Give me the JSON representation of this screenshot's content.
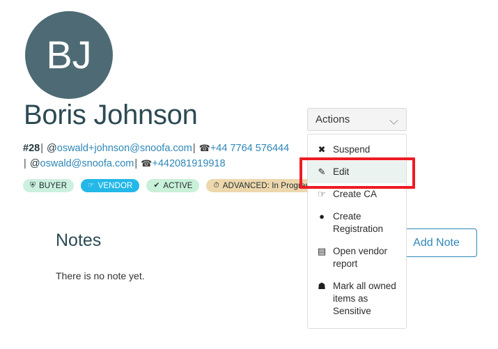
{
  "profile": {
    "avatar_initials": "BJ",
    "avatar_color": "#4e6b75",
    "name": "Boris Johnson",
    "id_label": "#28",
    "email_primary": "oswald+johnson@snoofa.com",
    "phone_primary": "+44 7764 576444",
    "email_secondary": "oswald@snoofa.com",
    "phone_secondary": "+442081919918",
    "separator": "|",
    "at_symbol": "@",
    "phone_icon_glyph": "☎",
    "link_color": "#2d87b8"
  },
  "badges": [
    {
      "label": "BUYER",
      "icon": "⛏",
      "icon_name": "basket-icon",
      "bg": "#ccf0e0",
      "fg": "#1f2b2b"
    },
    {
      "label": "VENDOR",
      "icon": "☞",
      "icon_name": "handshake-icon",
      "bg": "#23b8e8",
      "fg": "#ffffff"
    },
    {
      "label": "ACTIVE",
      "icon": "✔",
      "icon_name": "check-icon",
      "bg": "#c9f0d8",
      "fg": "#1f2b2b"
    },
    {
      "label": "ADVANCED: In Progress",
      "icon": "◴",
      "icon_name": "clock-icon",
      "bg": "#edd7ad",
      "fg": "#1f2b2b"
    }
  ],
  "notes": {
    "title": "Notes",
    "empty_message": "There is no note yet.",
    "add_button_label": "Add Note"
  },
  "actions": {
    "toggle_label": "Actions",
    "chevron_icon": "chevron-down-icon",
    "expanded": true,
    "items": [
      {
        "label": "Suspend",
        "icon": "✖",
        "icon_name": "times-icon",
        "active": false
      },
      {
        "label": "Edit",
        "icon": "✎",
        "icon_name": "pencil-icon",
        "active": true
      },
      {
        "label": "Create CA",
        "icon": "☞",
        "icon_name": "handshake-icon",
        "active": false
      },
      {
        "label": "Create Registration",
        "icon": "●",
        "icon_name": "user-circle-icon",
        "active": false
      },
      {
        "label": "Open vendor report",
        "icon": "▤",
        "icon_name": "chart-file-icon",
        "active": false
      },
      {
        "label": "Mark all owned items as Sensitive",
        "icon": "☗",
        "icon_name": "user-secret-icon",
        "active": false
      }
    ]
  },
  "annotation": {
    "highlight_color": "#ed1c24",
    "highlight_target": "Edit"
  }
}
